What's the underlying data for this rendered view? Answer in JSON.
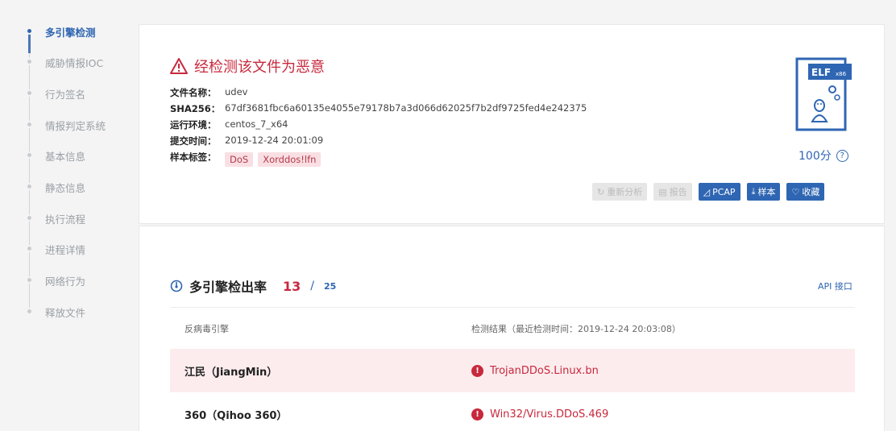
{
  "nav": {
    "items": [
      {
        "label": "多引擎检测",
        "active": true
      },
      {
        "label": "威胁情报IOC"
      },
      {
        "label": "行为签名"
      },
      {
        "label": "情报判定系统"
      },
      {
        "label": "基本信息"
      },
      {
        "label": "静态信息"
      },
      {
        "label": "执行流程"
      },
      {
        "label": "进程详情"
      },
      {
        "label": "网络行为"
      },
      {
        "label": "释放文件"
      }
    ]
  },
  "summary": {
    "verdict": "经检测该文件为恶意",
    "fields": [
      {
        "key": "文件名称：",
        "value": "udev"
      },
      {
        "key": "SHA256：",
        "value": "67df3681fbc6a60135e4055e79178b7a3d066d62025f7b2df9725fed4e242375"
      },
      {
        "key": "运行环境：",
        "value": "centos_7_x64"
      },
      {
        "key": "提交时间：",
        "value": "2019-12-24 20:01:09"
      },
      {
        "key": "样本标签：",
        "value": ""
      }
    ],
    "tags": [
      "DoS",
      "Xorddos!lfn"
    ],
    "file_badge": {
      "type": "ELF",
      "arch": "x86"
    },
    "score": "100分",
    "help_glyph": "?",
    "buttons": {
      "reanalyze": "重新分析",
      "report": "报告",
      "pcap": "PCAP",
      "sample": "样本",
      "favorite": "收藏"
    }
  },
  "detection": {
    "title": "多引擎检出率",
    "count": "13",
    "slash": "/",
    "total": "25",
    "api_link": "API 接口",
    "table": {
      "col_engine": "反病毒引擎",
      "col_result": "检测结果（最近检测时间：2019-12-24 20:03:08）",
      "rows": [
        {
          "engine": "江民（JiangMin）",
          "result": "TrojanDDoS.Linux.bn",
          "highlight": true
        },
        {
          "engine": "360（Qihoo 360）",
          "result": "Win32/Virus.DDoS.469",
          "highlight": false
        }
      ]
    }
  },
  "colors": {
    "accent": "#2f66b3",
    "danger": "#c8283c"
  }
}
